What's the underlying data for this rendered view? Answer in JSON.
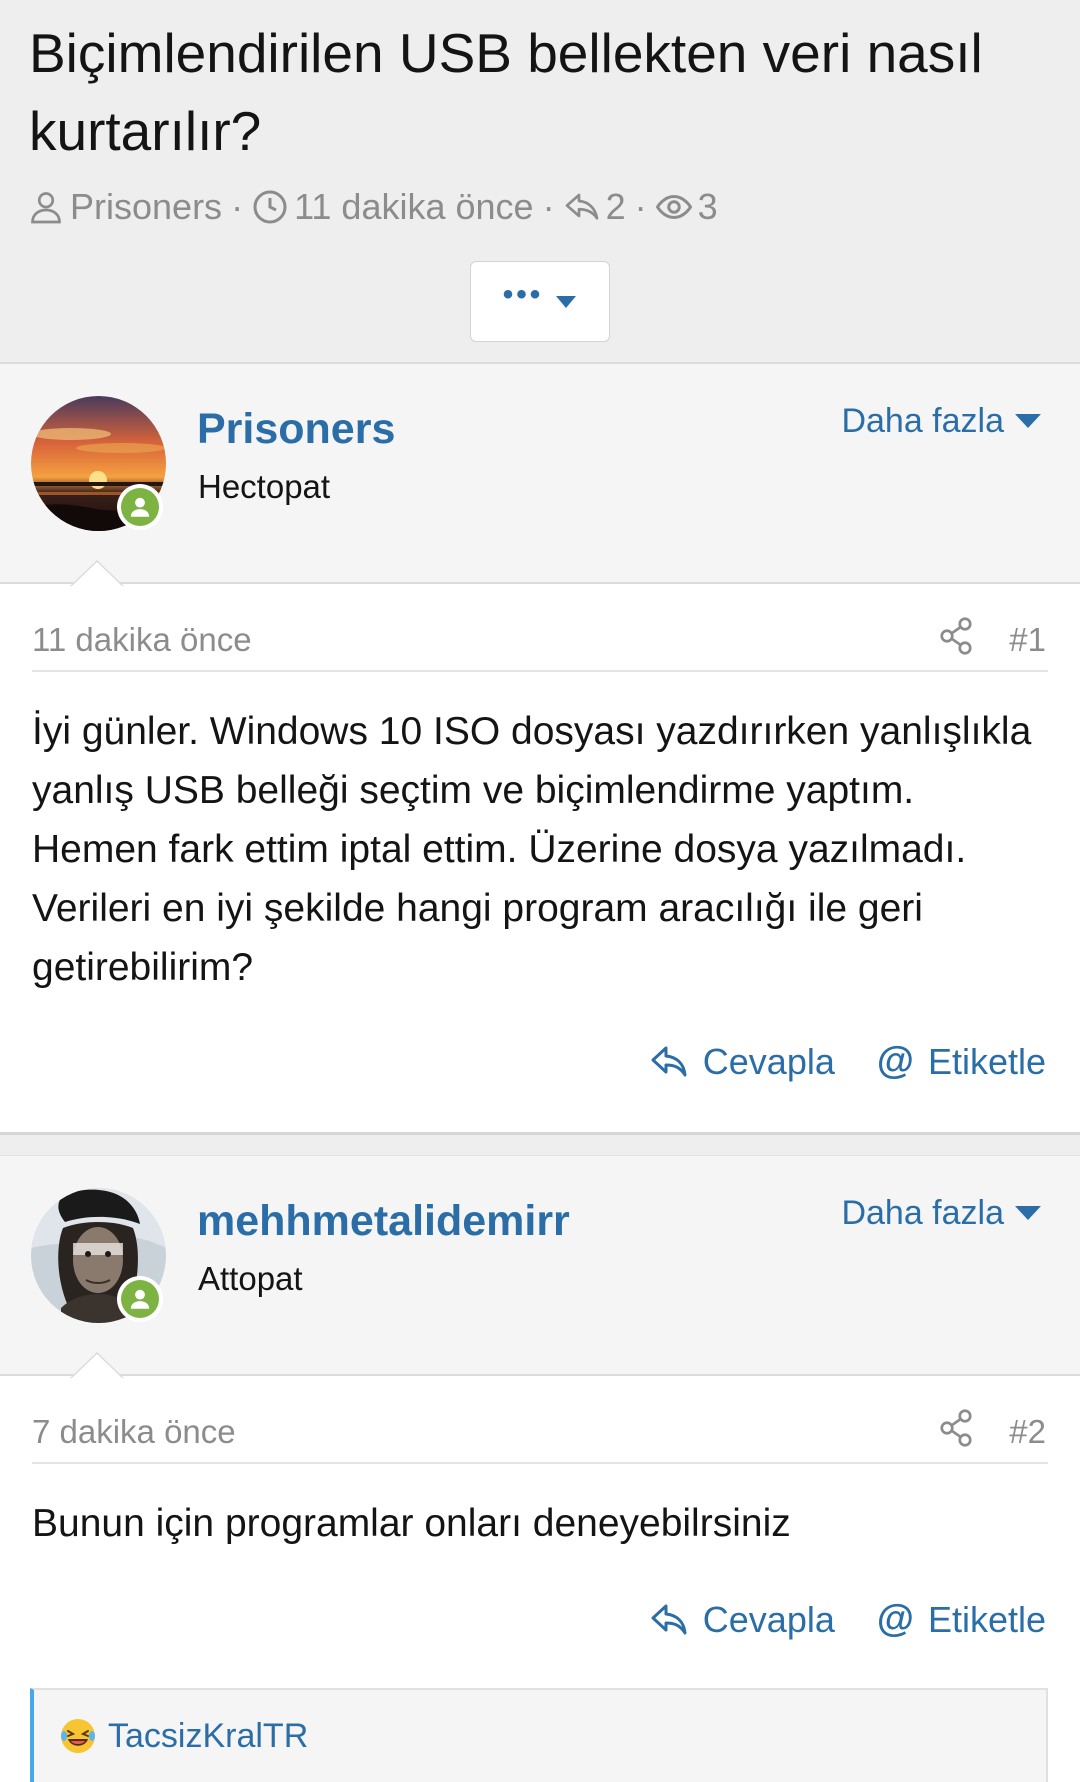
{
  "thread": {
    "title": "Biçimlendirilen USB bellekten veri nasıl kurtarılır?",
    "author": "Prisoners",
    "time": "11 dakika önce",
    "reply_count": "2",
    "view_count": "3",
    "meta_separator": "·"
  },
  "posts": [
    {
      "username": "Prisoners",
      "user_title": "Hectopat",
      "more_label": "Daha fazla",
      "date": "11 dakika önce",
      "number": "#1",
      "body": "İyi günler. Windows 10 ISO dosyası yazdırırken yanlışlıkla yanlış USB belleği seçtim ve biçimlendirme yaptım. Hemen fark ettim iptal ettim. Üzerine dosya yazılmadı. Verileri en iyi şekilde hangi program aracılığı ile geri getirebilirim?",
      "reply_label": "Cevapla",
      "tag_label": "Etiketle"
    },
    {
      "username": "mehhmetalidemirr",
      "user_title": "Attopat",
      "more_label": "Daha fazla",
      "date": "7 dakika önce",
      "number": "#2",
      "body": "Bunun için programlar onları deneyebilrsiniz",
      "reply_label": "Cevapla",
      "tag_label": "Etiketle"
    }
  ],
  "reactions": {
    "user": "TacsizKralTR",
    "emoji": "laughing-face"
  },
  "colors": {
    "link": "#2b6ea7",
    "online": "#7cb342",
    "reaction_accent": "#47a7eb"
  }
}
